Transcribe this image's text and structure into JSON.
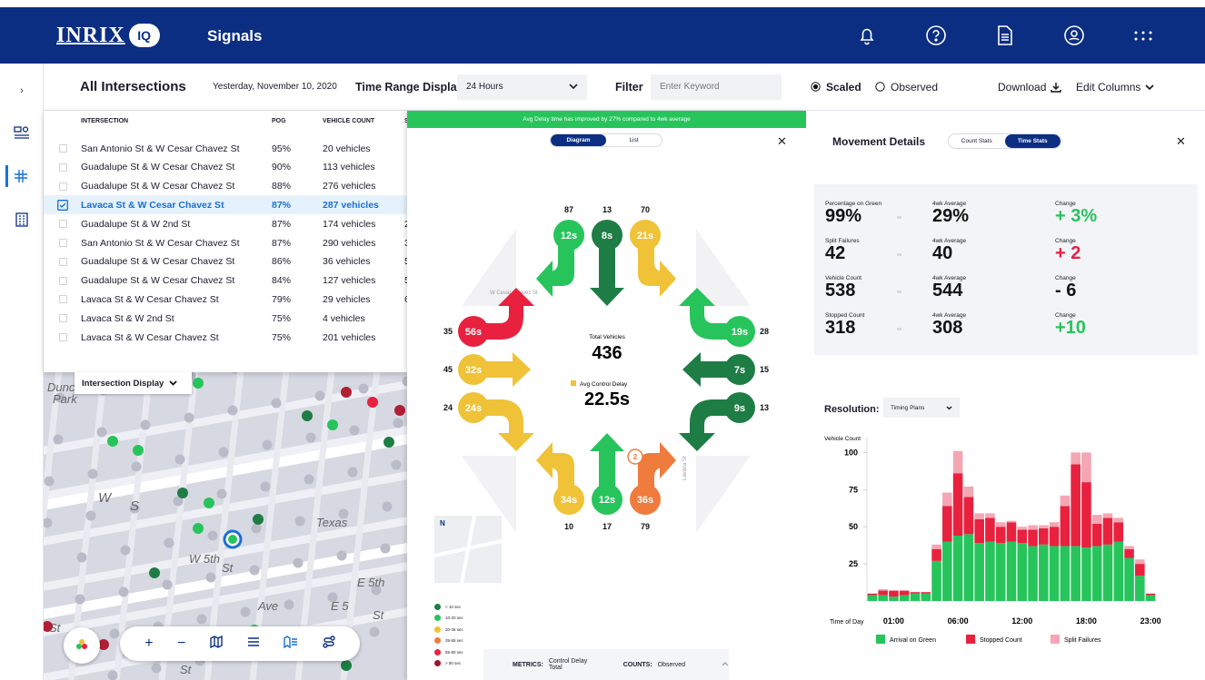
{
  "app": {
    "logo": "INRIX",
    "logo_badge": "IQ",
    "name": "Signals"
  },
  "topbar_icons": [
    "bell-icon",
    "help-icon",
    "document-icon",
    "user-icon",
    "apps-grid-icon"
  ],
  "filterbar": {
    "title": "All Intersections",
    "date": "Yesterday, November 10, 2020",
    "time_range_label": "Time Range Display",
    "time_range_value": "24 Hours",
    "filter_label": "Filter",
    "filter_placeholder": "Enter Keyword",
    "scaled": "Scaled",
    "observed": "Observed",
    "download": "Download",
    "edit_columns": "Edit Columns"
  },
  "table": {
    "headers": [
      "INTERSECTION",
      "POG",
      "VEHICLE COUNT",
      "S"
    ],
    "rows": [
      {
        "name": "San Antonio St & W Cesar Chavez St",
        "pog": "95%",
        "count": "20 vehicles",
        "extra": "",
        "selected": false
      },
      {
        "name": "Guadalupe St & W Cesar Chavez St",
        "pog": "90%",
        "count": "113 vehicles",
        "extra": "",
        "selected": false
      },
      {
        "name": "Guadalupe St & W Cesar Chavez St",
        "pog": "88%",
        "count": "276 vehicles",
        "extra": "",
        "selected": false
      },
      {
        "name": "Lavaca St & W Cesar Chavez St",
        "pog": "87%",
        "count": "287 vehicles",
        "extra": "",
        "selected": true
      },
      {
        "name": "Guadalupe St & W 2nd St",
        "pog": "87%",
        "count": "174 vehicles",
        "extra": "2",
        "selected": false
      },
      {
        "name": "San Antonio St & W Cesar Chavez St",
        "pog": "87%",
        "count": "290 vehicles",
        "extra": "3",
        "selected": false
      },
      {
        "name": "Guadalupe St & W Cesar Chavez St",
        "pog": "86%",
        "count": "36 vehicles",
        "extra": "5",
        "selected": false
      },
      {
        "name": "Guadalupe St & W Cesar Chavez St",
        "pog": "84%",
        "count": "127 vehicles",
        "extra": "5",
        "selected": false
      },
      {
        "name": "Lavaca St & W Cesar Chavez St",
        "pog": "79%",
        "count": "29 vehicles",
        "extra": "6",
        "selected": false
      },
      {
        "name": "Lavaca St & W 2nd St",
        "pog": "75%",
        "count": "4 vehicles",
        "extra": "",
        "selected": false
      },
      {
        "name": "Lavaca St & W Cesar Chavez St",
        "pog": "75%",
        "count": "201 vehicles",
        "extra": "",
        "selected": false
      }
    ]
  },
  "map": {
    "intersection_display": "Intersection Display",
    "labels": {
      "park1": "Dunc",
      "park2": "Park",
      "w": "W",
      "s": "S",
      "texas": "Texas",
      "w5th": "W 5th",
      "st": "St",
      "e5th": "E 5th",
      "e5": "E 5",
      "e5st": "St",
      "ave": "Ave",
      "st2": "St",
      "st3": "St"
    }
  },
  "diagram": {
    "banner": "Avg Delay time has improved by 27% compared to 4wk average",
    "tab_diagram": "Diagram",
    "tab_list": "List",
    "total_label": "Total Vehicles",
    "total_value": "436",
    "delay_label": "Avg Control Delay",
    "delay_value": "22.5s",
    "street_left": "W Cesar Chavez St",
    "street_right": "Lavaca St",
    "north": "N",
    "top_counts": [
      "87",
      "13",
      "70"
    ],
    "top_times": [
      "12s",
      "8s",
      "21s"
    ],
    "left_counts": [
      "35",
      "45",
      "24"
    ],
    "left_times": [
      "56s",
      "32s",
      "24s"
    ],
    "right_counts": [
      "28",
      "15",
      "13"
    ],
    "right_times": [
      "19s",
      "7s",
      "9s"
    ],
    "bottom_counts": [
      "10",
      "17",
      "79"
    ],
    "bottom_times": [
      "34s",
      "12s",
      "36s"
    ],
    "badge": "2",
    "legend": [
      "< 10 sec",
      "10-20 sec",
      "20-35 sec",
      "35-55 sec",
      "55-80 sec",
      "> 80 sec"
    ],
    "legend_colors": [
      "#1e7d45",
      "#27c45c",
      "#efc238",
      "#ef7b3d",
      "#e8213f",
      "#a0122d"
    ],
    "metrics_label": "METRICS:",
    "metrics_value": "Control Delay Total",
    "counts_label": "COUNTS:",
    "counts_value": "Observed"
  },
  "details": {
    "title": "Movement Details",
    "tab_count": "Count Stats",
    "tab_time": "Time Stats",
    "rows": [
      {
        "label": "Percentage on Green",
        "value": "99%",
        "avg_label": "4wk Average",
        "avg": "29%",
        "change_label": "Change",
        "change": "+ 3%",
        "tone": "green"
      },
      {
        "label": "Split Failures",
        "value": "42",
        "avg_label": "4wk Average",
        "avg": "40",
        "change_label": "Change",
        "change": "+ 2",
        "tone": "red"
      },
      {
        "label": "Vehicle Count",
        "value": "538",
        "avg_label": "4wk Average",
        "avg": "544",
        "change_label": "Change",
        "change": "- 6",
        "tone": "dark"
      },
      {
        "label": "Stopped Count",
        "value": "318",
        "avg_label": "4wk Average",
        "avg": "308",
        "change_label": "Change",
        "change": "+10",
        "tone": "green"
      }
    ],
    "vs": "vs",
    "resolution_label": "Resolution:",
    "resolution_value": "Timing Plans"
  },
  "chart_data": {
    "type": "bar",
    "stacked": true,
    "ylabel": "Vehicle Count",
    "xlabel": "Time of Day",
    "ylim": [
      0,
      110
    ],
    "yticks": [
      25,
      50,
      75,
      100
    ],
    "xtick_labels": [
      "01:00",
      "06:00",
      "12:00",
      "18:00",
      "23:00"
    ],
    "xtick_index": [
      2,
      8,
      14,
      20,
      26
    ],
    "series": [
      {
        "name": "Arrival on Green",
        "color": "#27c45c",
        "values": [
          4,
          4,
          3,
          4,
          5,
          5,
          27,
          40,
          44,
          45,
          39,
          40,
          39,
          40,
          39,
          37,
          38,
          37,
          37,
          37,
          36,
          37,
          38,
          40,
          29,
          17,
          4
        ]
      },
      {
        "name": "Stopped Count",
        "color": "#e8213f",
        "values": [
          1,
          3,
          4,
          3,
          1,
          1,
          8,
          24,
          42,
          25,
          16,
          16,
          11,
          13,
          9,
          11,
          11,
          13,
          27,
          55,
          44,
          15,
          18,
          13,
          6,
          8,
          1
        ]
      },
      {
        "name": "Split Failures",
        "color": "#f4a6b4",
        "values": [
          0,
          1,
          0,
          0,
          0,
          0,
          3,
          9,
          15,
          7,
          4,
          3,
          3,
          1,
          2,
          3,
          2,
          3,
          7,
          8,
          20,
          6,
          3,
          3,
          2,
          3,
          0
        ]
      }
    ]
  }
}
